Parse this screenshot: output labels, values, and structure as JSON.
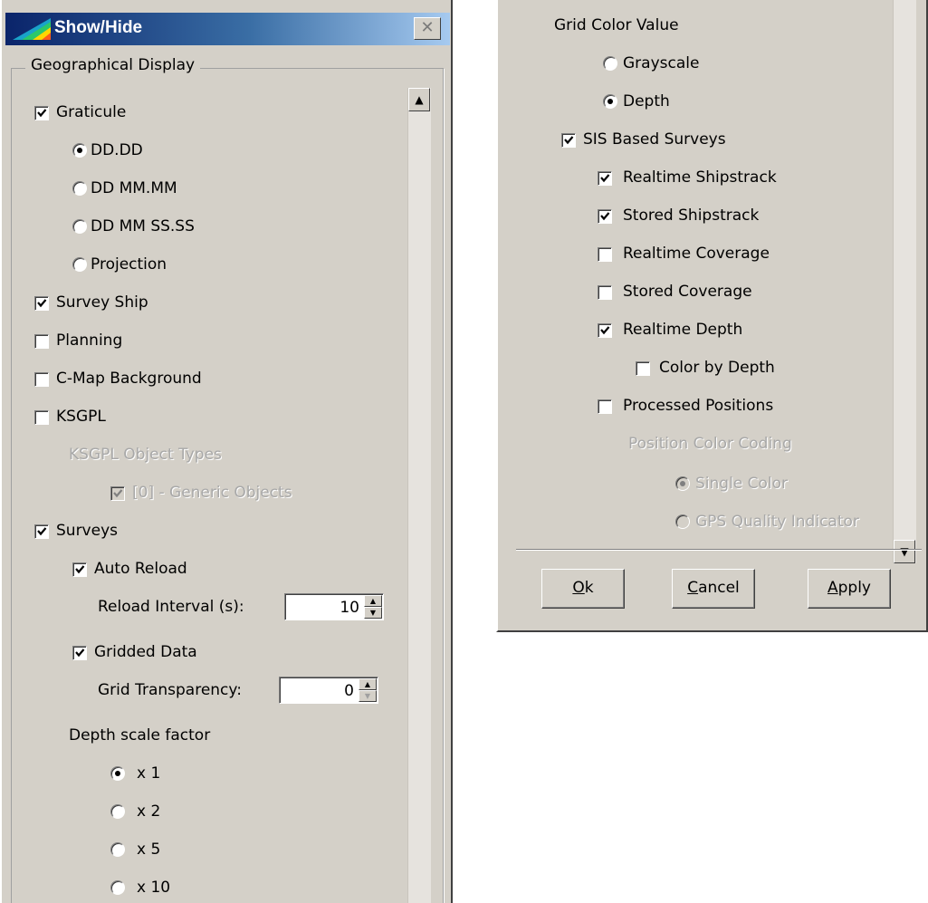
{
  "window": {
    "title": "Show/Hide",
    "close_label": "✕"
  },
  "geo_display": {
    "group_title": "Geographical Display",
    "graticule": {
      "label": "Graticule",
      "checked": true
    },
    "formats": [
      {
        "label": "DD.DD",
        "selected": true
      },
      {
        "label": "DD MM.MM",
        "selected": false
      },
      {
        "label": "DD MM SS.SS",
        "selected": false
      },
      {
        "label": "Projection",
        "selected": false
      }
    ],
    "survey_ship": {
      "label": "Survey Ship",
      "checked": true
    },
    "planning": {
      "label": "Planning",
      "checked": false
    },
    "cmap_background": {
      "label": "C-Map Background",
      "checked": false
    },
    "ksgpl": {
      "label": "KSGPL",
      "checked": false
    },
    "ksgpl_object_types": {
      "label": "KSGPL Object Types"
    },
    "generic_objects": {
      "label": "[0] - Generic Objects",
      "checked": true,
      "disabled": true
    },
    "surveys": {
      "label": "Surveys",
      "checked": true
    },
    "auto_reload": {
      "label": "Auto Reload",
      "checked": true
    },
    "reload_interval": {
      "label": "Reload Interval (s):",
      "value": "10"
    },
    "gridded_data": {
      "label": "Gridded Data",
      "checked": true
    },
    "grid_transparency": {
      "label": "Grid Transparency:",
      "value": "0"
    },
    "depth_scale": {
      "label": "Depth scale factor",
      "options": [
        {
          "label": "x 1",
          "selected": true
        },
        {
          "label": "x 2",
          "selected": false
        },
        {
          "label": "x 5",
          "selected": false
        },
        {
          "label": "x 10",
          "selected": false
        }
      ]
    }
  },
  "right": {
    "grid_color_value": {
      "label": "Grid Color Value",
      "options": [
        {
          "label": "Grayscale",
          "selected": false
        },
        {
          "label": "Depth",
          "selected": true
        }
      ]
    },
    "sis_based_surveys": {
      "label": "SIS Based Surveys",
      "checked": true
    },
    "realtime_shipstrack": {
      "label": "Realtime Shipstrack",
      "checked": true
    },
    "stored_shipstrack": {
      "label": "Stored Shipstrack",
      "checked": true
    },
    "realtime_coverage": {
      "label": "Realtime Coverage",
      "checked": false
    },
    "stored_coverage": {
      "label": "Stored Coverage",
      "checked": false
    },
    "realtime_depth": {
      "label": "Realtime Depth",
      "checked": true
    },
    "color_by_depth": {
      "label": "Color by Depth",
      "checked": false
    },
    "processed_positions": {
      "label": "Processed Positions",
      "checked": false
    },
    "position_color_coding": {
      "label": "Position Color Coding",
      "options": [
        {
          "label": "Single Color",
          "selected": true,
          "disabled": true
        },
        {
          "label": "GPS Quality Indicator",
          "selected": false,
          "disabled": true
        }
      ]
    }
  },
  "buttons": {
    "ok": {
      "mnemonic": "O",
      "rest": "k"
    },
    "cancel": {
      "mnemonic": "C",
      "rest": "ancel"
    },
    "apply": {
      "mnemonic": "A",
      "rest": "pply"
    }
  }
}
